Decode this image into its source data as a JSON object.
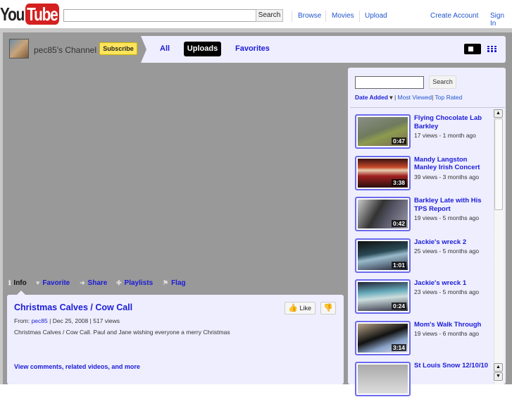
{
  "header": {
    "logo_you": "You",
    "logo_tube": "Tube",
    "search_btn": "Search",
    "links": [
      "Browse",
      "Movies",
      "Upload"
    ],
    "create_account": "Create Account",
    "sign_in": "Sign In"
  },
  "channel": {
    "name": "pec85's Channel",
    "subscribe": "Subscribe",
    "tabs": {
      "all": "All",
      "uploads": "Uploads",
      "favorites": "Favorites"
    }
  },
  "video_tabs": [
    {
      "icon": "info-icon",
      "glyph": "ℹ",
      "label": "Info"
    },
    {
      "icon": "heart-icon",
      "glyph": "♥",
      "label": "Favorite"
    },
    {
      "icon": "arrow-icon",
      "glyph": "➜",
      "label": "Share"
    },
    {
      "icon": "plus-icon",
      "glyph": "✚",
      "label": "Playlists"
    },
    {
      "icon": "flag-icon",
      "glyph": "⚑",
      "label": "Flag"
    }
  ],
  "video": {
    "title": "Christmas Calves / Cow Call",
    "from_label": "From:",
    "author": "pec85",
    "date": "| Dec 25, 2008",
    "views": "| 517 views",
    "description": "Christmas Calves / Cow Call. Paul and Jane wishing everyone a merry Christmas",
    "more_link": "View comments, related videos, and more",
    "like": "Like"
  },
  "sidebar": {
    "search_btn": "Search",
    "sort": {
      "date_added": "Date Added",
      "sep": "|",
      "most_viewed": "Most Viewed",
      "top_rated": "Top Rated"
    },
    "items": [
      {
        "title": "Flying Chocolate Lab Barkley",
        "meta": "17 views - 1 month ago",
        "duration": "0:47",
        "thumb": "linear-gradient(160deg,#8a8f86,#6f7a5e 45%,#8c9a4e 60%,#7a6a55)"
      },
      {
        "title": "Mandy Langston Manley Irish Concert",
        "meta": "39 views - 3 months ago",
        "duration": "3:38",
        "thumb": "linear-gradient(180deg,#3a1010,#c84a2a 30%,#e8d0b0 40%,#a02020 60%,#2a1010)"
      },
      {
        "title": "Barkley Late with His TPS Report",
        "meta": "19 views - 5 months ago",
        "duration": "0:42",
        "thumb": "linear-gradient(120deg,#ccc,#333 40%,#556 60%,#99a)"
      },
      {
        "title": "Jackie's wreck 2",
        "meta": "25 views - 5 months ago",
        "duration": "1:01",
        "thumb": "linear-gradient(170deg,#111,#2a4a55 40%,#9bc 55%,#223)"
      },
      {
        "title": "Jackie's wreck 1",
        "meta": "23 views - 5 months ago",
        "duration": "0:24",
        "thumb": "linear-gradient(175deg,#223,#6ab 35%,#cdd 55%,#334)"
      },
      {
        "title": "Mom's Walk Through",
        "meta": "19 views - 6 months ago",
        "duration": "3:14",
        "thumb": "linear-gradient(160deg,#b9a48a,#111 45%,#8aa4c8 70%,#dde)"
      },
      {
        "title": "St Louis Snow 12/10/10",
        "meta": "",
        "duration": "",
        "thumb": "linear-gradient(180deg,#aaa,#ddd)"
      }
    ]
  }
}
